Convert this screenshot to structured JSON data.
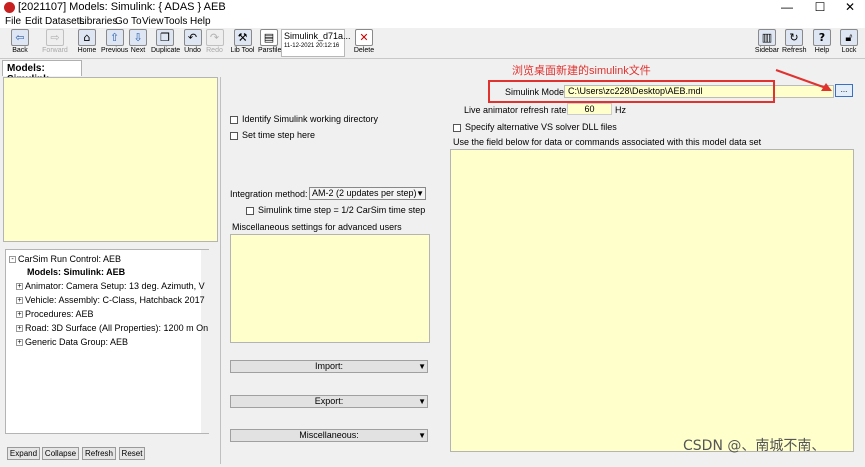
{
  "window": {
    "title": "[2021107] Models: Simulink: { ADAS } AEB",
    "minimize": "—",
    "maximize": "☐",
    "close": "✕"
  },
  "menu": [
    "File",
    "Edit",
    "Datasets",
    "Libraries",
    "Go To",
    "View",
    "Tools",
    "Help"
  ],
  "toolbar": {
    "back": "Back",
    "forward": "Forward",
    "home": "Home",
    "previous": "Previous",
    "next": "Next",
    "duplicate": "Duplicate",
    "undo": "Undo",
    "redo": "Redo",
    "lib_tool": "Lib Tool",
    "parsfile": "Parsfile",
    "dataset_name": "Simulink_d71a...",
    "dataset_date": "11-12-2021 20:12:16",
    "delete": "Delete",
    "sidebar": "Sidebar",
    "refresh": "Refresh",
    "help": "Help",
    "lock": "Lock"
  },
  "tab": "Models: Simulink",
  "tree": [
    {
      "label": "CarSim Run Control: AEB",
      "expander": "-",
      "bold": false
    },
    {
      "label": "Models: Simulink: AEB",
      "expander": "",
      "bold": true
    },
    {
      "label": "Animator: Camera Setup: 13 deg. Azimuth, V",
      "expander": "+",
      "bold": false
    },
    {
      "label": "Vehicle: Assembly: C-Class, Hatchback 2017",
      "expander": "+",
      "bold": false
    },
    {
      "label": "Procedures: AEB",
      "expander": "+",
      "bold": false
    },
    {
      "label": "Road: 3D Surface (All Properties): 1200 m On",
      "expander": "+",
      "bold": false
    },
    {
      "label": "Generic Data Group: AEB",
      "expander": "+",
      "bold": false
    }
  ],
  "tree_buttons": {
    "expand": "Expand",
    "collapse": "Collapse",
    "refresh": "Refresh",
    "reset": "Reset"
  },
  "middle": {
    "identify_wd": "Identify Simulink working directory",
    "set_time_step": "Set time step here",
    "integration_label": "Integration method:",
    "integration_value": "AM-2 (2 updates per step)",
    "simulink_time_step": "Simulink time step = 1/2 CarSim time step",
    "misc_label": "Miscellaneous settings for advanced users",
    "import": "Import:",
    "export": "Export:",
    "miscellaneous": "Miscellaneous:"
  },
  "right": {
    "model_label": "Simulink Model:",
    "model_path": "C:\\Users\\zc228\\Desktop\\AEB.mdl",
    "browse": "...",
    "anim_label": "Live animator refresh rate:",
    "anim_value": "60",
    "anim_unit": "Hz",
    "specify_vs": "Specify alternative VS solver DLL files",
    "field_desc": "Use the field below  for data or commands associated with this model data set"
  },
  "annotation": {
    "text": "浏览桌面新建的simulink文件",
    "color": "#e0322f"
  },
  "watermark": "CSDN @、南城不南、"
}
